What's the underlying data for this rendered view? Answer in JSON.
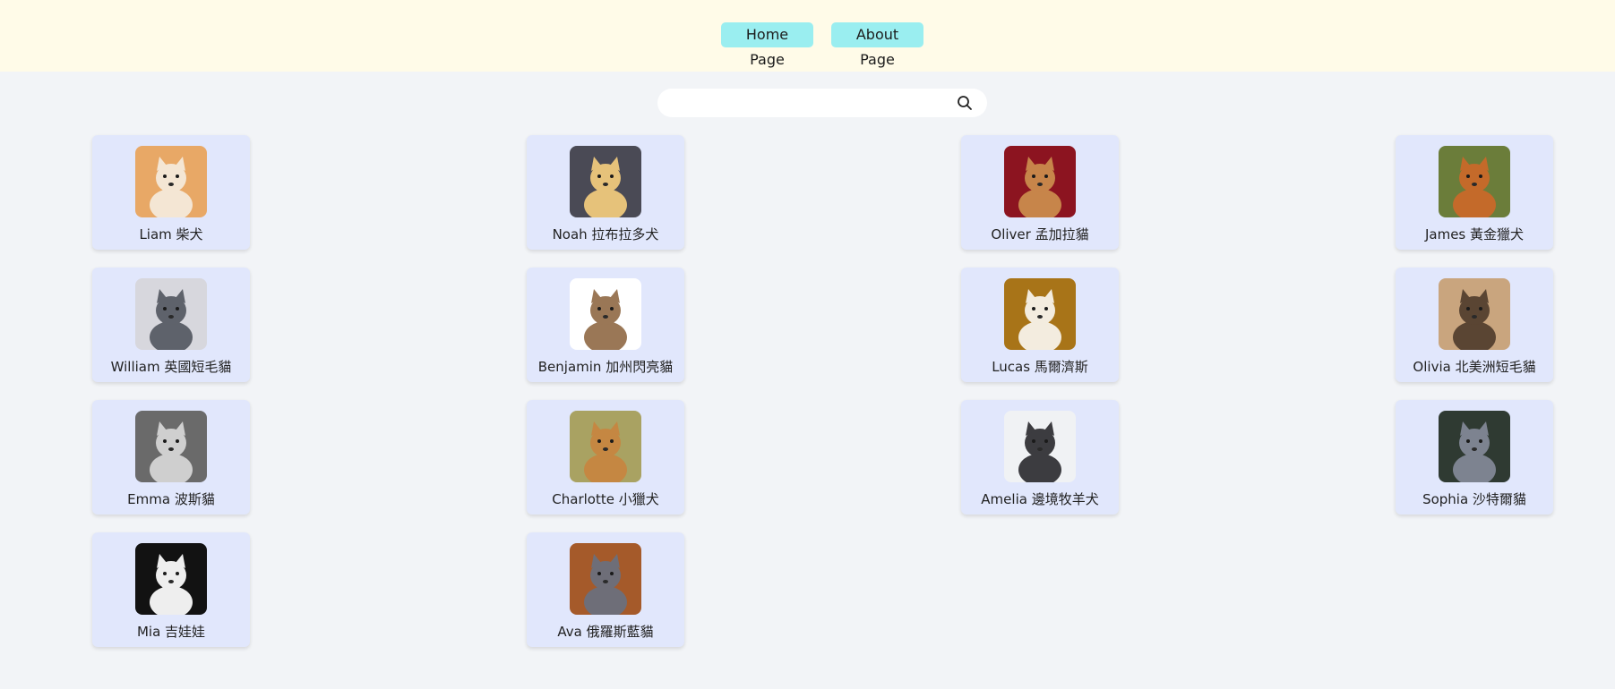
{
  "nav": {
    "home_label": "Home Page",
    "about_label": "About Page"
  },
  "search": {
    "value": "",
    "placeholder": ""
  },
  "pets": [
    {
      "label": "Liam 柴犬",
      "icon": "shiba-dog-photo",
      "bg": "#e8a866",
      "fg": "#f4e6d4"
    },
    {
      "label": "Noah 拉布拉多犬",
      "icon": "labrador-dog-photo",
      "bg": "#4a4a55",
      "fg": "#e6c27a"
    },
    {
      "label": "Oliver 孟加拉貓",
      "icon": "bengal-cat-photo",
      "bg": "#8c1420",
      "fg": "#c7854a"
    },
    {
      "label": "James 黃金獵犬",
      "icon": "golden-retriever-photo",
      "bg": "#6b7d3a",
      "fg": "#c46a2a"
    },
    {
      "label": "William 英國短毛貓",
      "icon": "british-shorthair-cat-photo",
      "bg": "#d7d7dd",
      "fg": "#5e626b"
    },
    {
      "label": "Benjamin 加州閃亮貓",
      "icon": "california-spangled-cat-photo",
      "bg": "#ffffff",
      "fg": "#9a7756"
    },
    {
      "label": "Lucas 馬爾濟斯",
      "icon": "maltese-dog-photo",
      "bg": "#a87418",
      "fg": "#f3ecdf"
    },
    {
      "label": "Olivia 北美洲短毛貓",
      "icon": "american-shorthair-cat-photo",
      "bg": "#c9a57e",
      "fg": "#5a4533"
    },
    {
      "label": "Emma 波斯貓",
      "icon": "persian-cat-photo",
      "bg": "#6a6a6a",
      "fg": "#cfcfcf"
    },
    {
      "label": "Charlotte 小獵犬",
      "icon": "beagle-dog-photo",
      "bg": "#a9a262",
      "fg": "#c58742"
    },
    {
      "label": "Amelia 邊境牧羊犬",
      "icon": "border-collie-photo",
      "bg": "#f0f2f4",
      "fg": "#3c3c40"
    },
    {
      "label": "Sophia 沙特爾貓",
      "icon": "chartreux-cat-photo",
      "bg": "#2f3a32",
      "fg": "#7d8390"
    },
    {
      "label": "Mia 吉娃娃",
      "icon": "chihuahua-dog-photo",
      "bg": "#121212",
      "fg": "#eeeeee"
    },
    {
      "label": "Ava 俄羅斯藍貓",
      "icon": "russian-blue-cat-photo",
      "bg": "#a55a2a",
      "fg": "#6e6e78"
    }
  ]
}
